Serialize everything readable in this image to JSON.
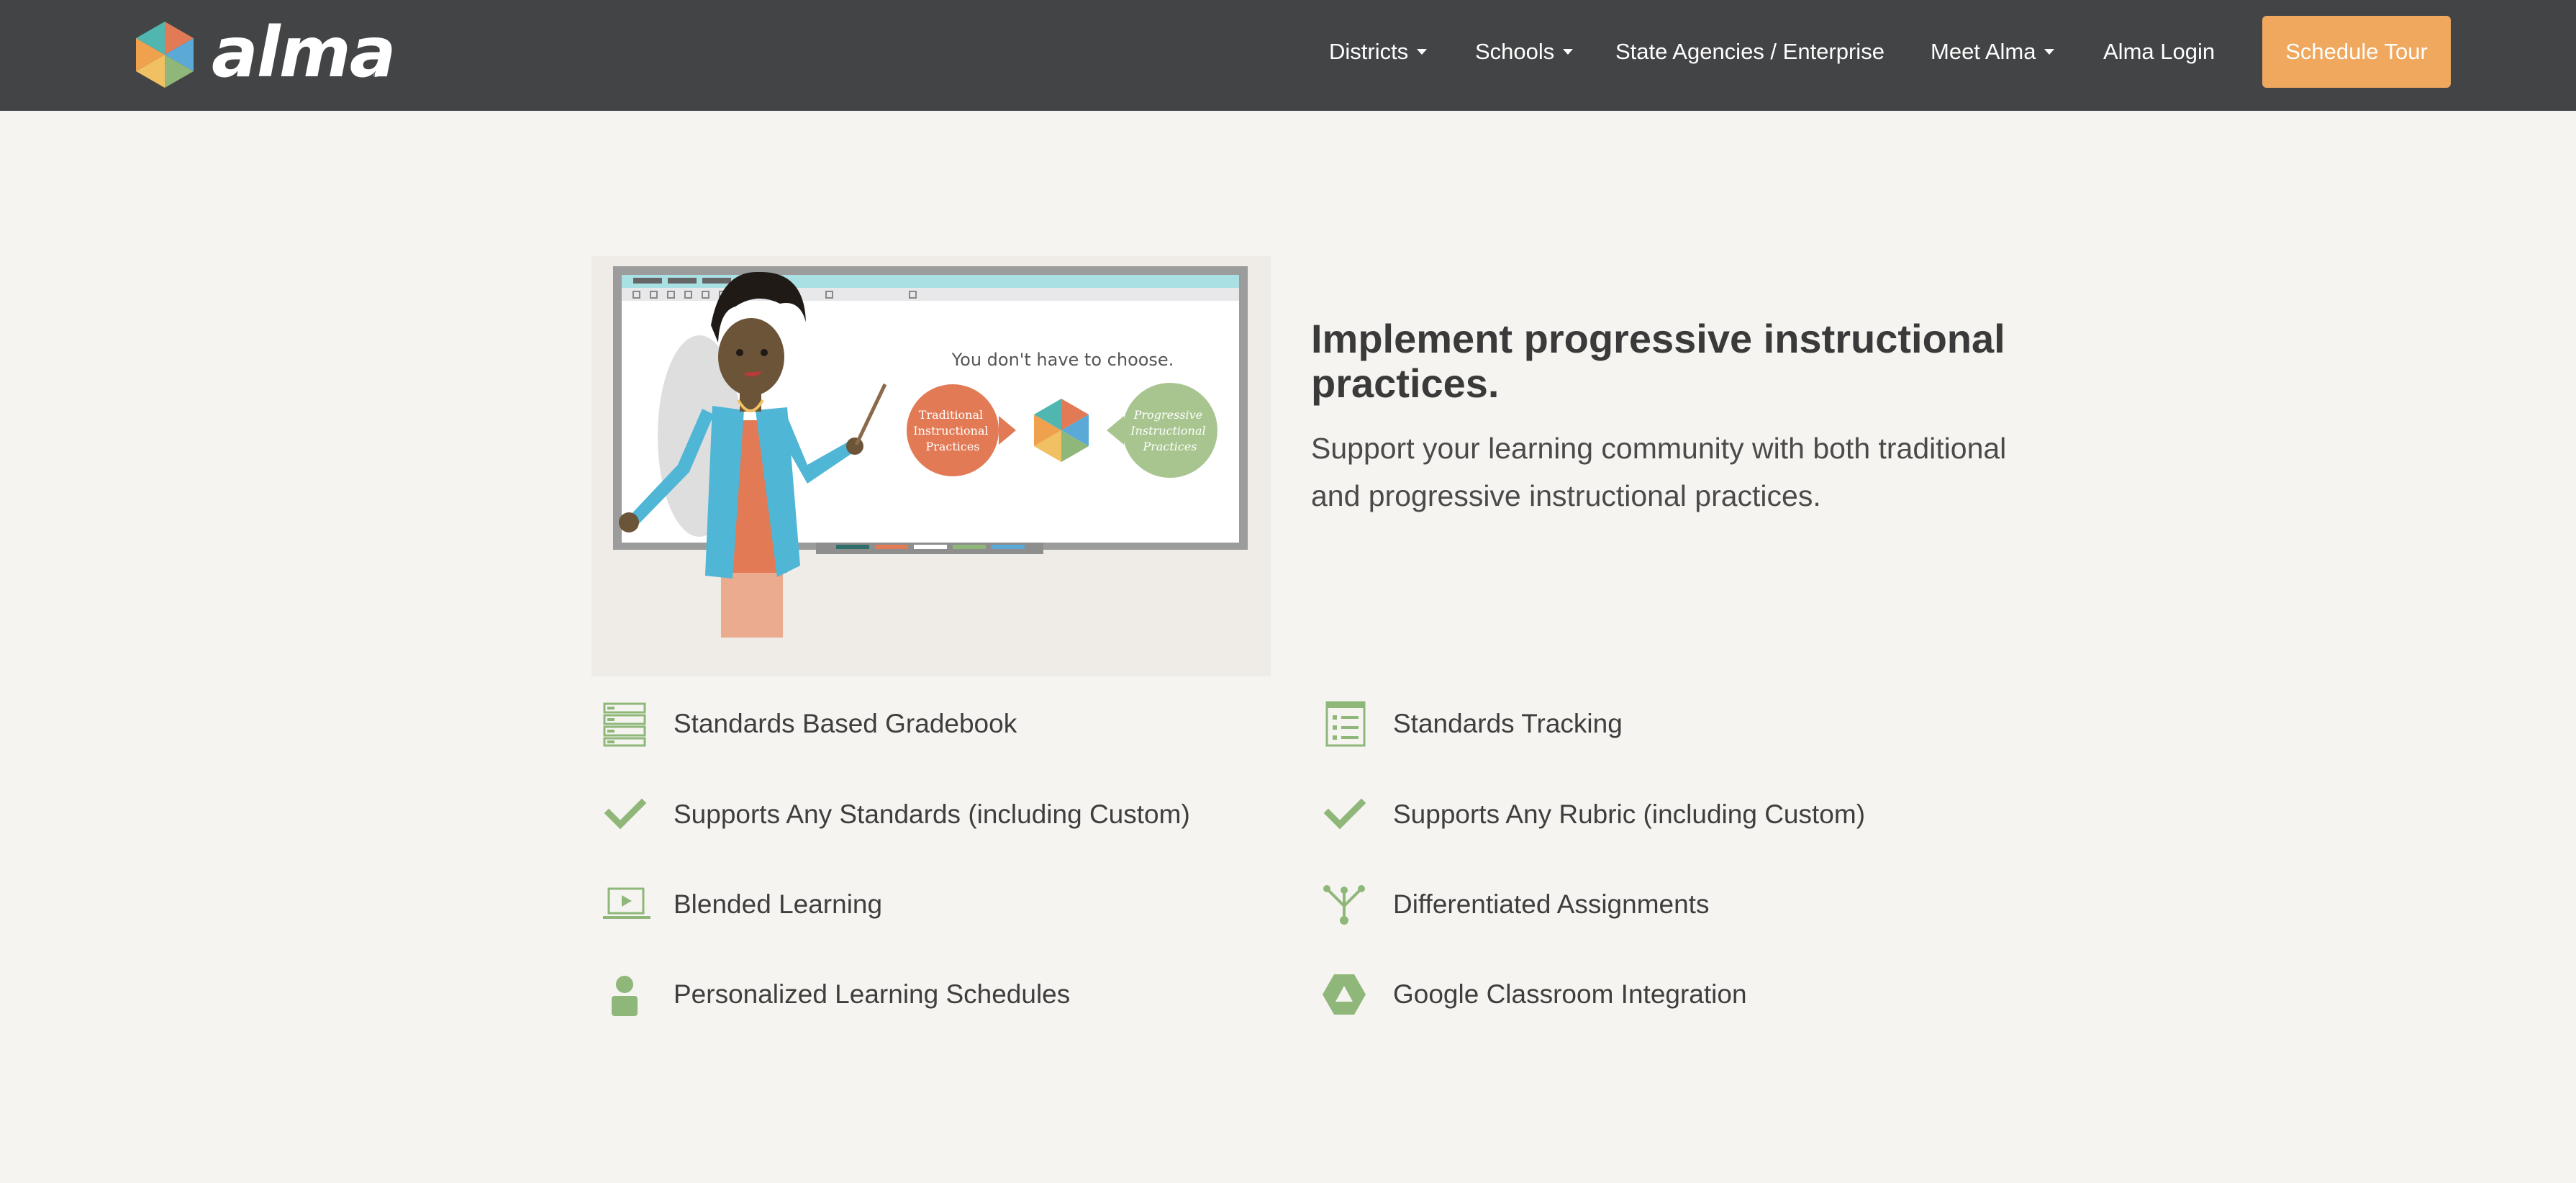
{
  "brand": {
    "name": "alma",
    "colors": {
      "nav_bg": "#434446",
      "cta": "#f0a85e",
      "icon_green": "#8fb77a",
      "accent_orange": "#e27a55"
    }
  },
  "nav": {
    "items": [
      {
        "label": "Districts",
        "has_dropdown": true
      },
      {
        "label": "Schools",
        "has_dropdown": true
      },
      {
        "label": "State Agencies / Enterprise",
        "has_dropdown": false
      },
      {
        "label": "Meet Alma",
        "has_dropdown": true
      },
      {
        "label": "Alma Login",
        "has_dropdown": false
      }
    ],
    "cta_label": "Schedule Tour"
  },
  "hero": {
    "illustration": {
      "board_title": "You don't have to choose.",
      "left_bubble": [
        "Traditional",
        "Instructional",
        "Practices"
      ],
      "right_bubble": [
        "Progressive",
        "Instructional",
        "Practices"
      ]
    },
    "title": "Implement progressive instructional practices.",
    "subtitle": "Support your learning community with both traditional and progressive instructional practices."
  },
  "features": [
    {
      "label": "Standards Based Gradebook",
      "icon": "gradebook-list-icon"
    },
    {
      "label": "Standards Tracking",
      "icon": "checklist-document-icon"
    },
    {
      "label": "Supports Any Standards (including Custom)",
      "icon": "checkmark-icon"
    },
    {
      "label": "Supports Any Rubric (including Custom)",
      "icon": "checkmark-icon"
    },
    {
      "label": "Blended Learning",
      "icon": "laptop-play-icon"
    },
    {
      "label": "Differentiated Assignments",
      "icon": "branching-icon"
    },
    {
      "label": "Personalized Learning Schedules",
      "icon": "person-icon"
    },
    {
      "label": "Google Classroom Integration",
      "icon": "google-classroom-icon"
    }
  ]
}
